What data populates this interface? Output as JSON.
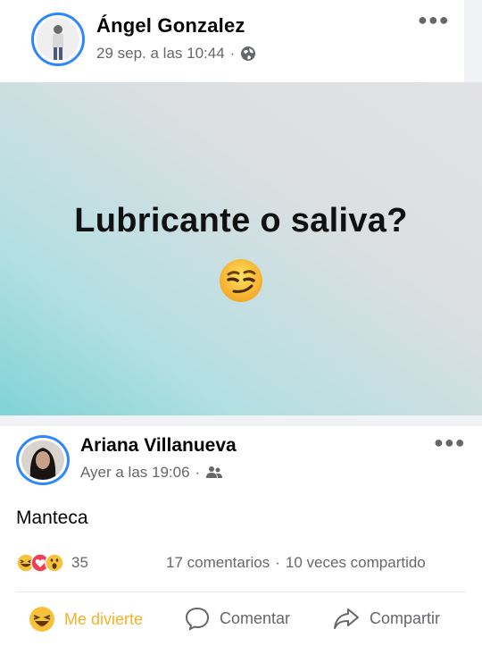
{
  "post1": {
    "author": "Ángel Gonzalez",
    "timestamp": "29 sep. a las 10:44",
    "privacy_icon": "globe-icon",
    "caption": "Lubricante o saliva?",
    "emoji": "smirking-face"
  },
  "post2": {
    "author": "Ariana Villanueva",
    "timestamp": "Ayer a las 19:06",
    "privacy_icon": "friends-icon",
    "text": "Manteca",
    "reactions": {
      "count": "35",
      "types": [
        "haha",
        "love",
        "wow"
      ]
    },
    "stats": {
      "comments": "17 comentarios",
      "shares": "10 veces compartido"
    },
    "actions": {
      "react_label": "Me divierte",
      "comment_label": "Comentar",
      "share_label": "Compartir"
    }
  },
  "separator": "·",
  "colors": {
    "accent": "#2d88ff",
    "secondary_text": "#65676b",
    "reacted": "#f7b125"
  }
}
